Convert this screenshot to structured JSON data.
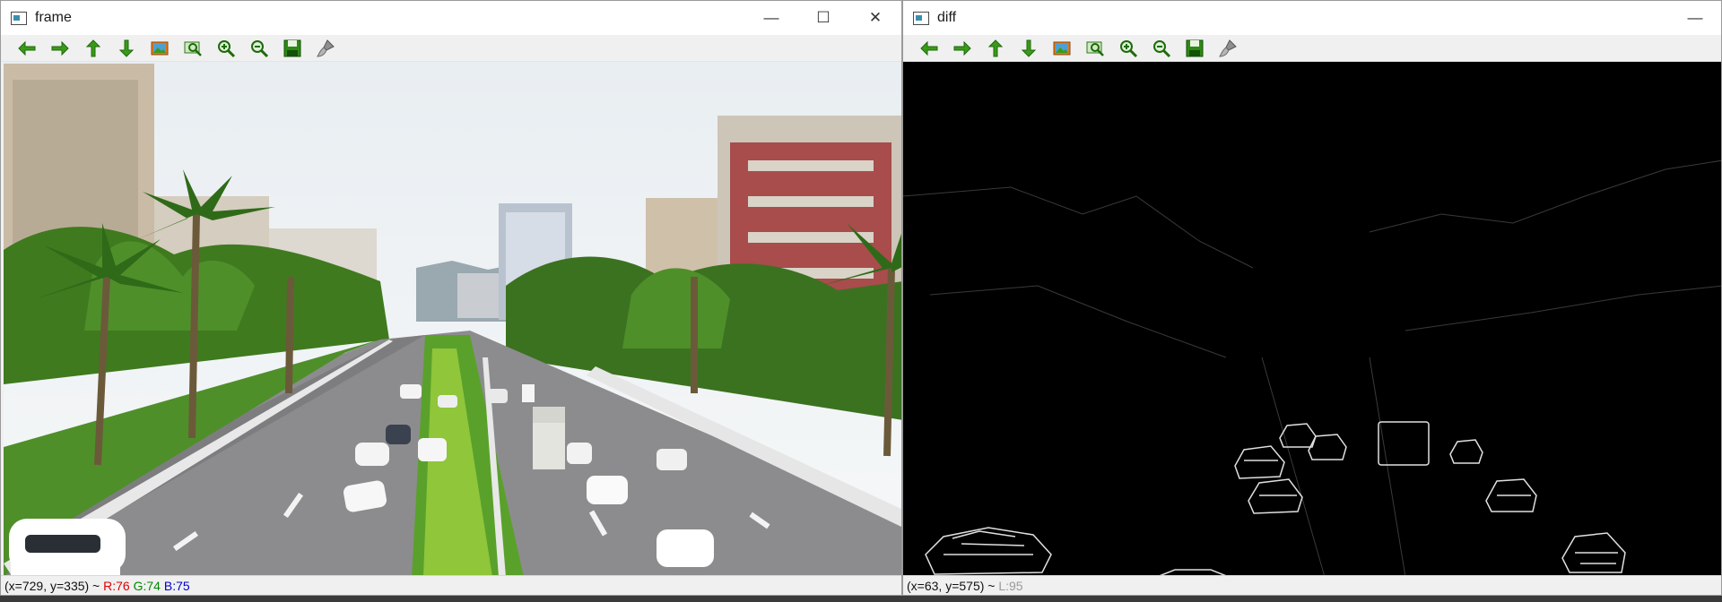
{
  "frame_window": {
    "title": "frame",
    "status": {
      "coords": "(x=729, y=335) ~",
      "r": "R:76",
      "g": "G:74",
      "b": "B:75"
    }
  },
  "diff_window": {
    "title": "diff",
    "status": {
      "coords": "(x=63, y=575) ~",
      "l": "L:95"
    }
  },
  "window_controls": {
    "minimize": "—",
    "maximize": "☐",
    "close": "✕"
  },
  "toolbar_icons": [
    "arrow-left-icon",
    "arrow-right-icon",
    "arrow-up-icon",
    "arrow-down-icon",
    "image-icon",
    "zoom-rect-icon",
    "zoom-in-icon",
    "zoom-out-icon",
    "save-icon",
    "brush-icon"
  ],
  "colors": {
    "toolbar_green": "#3a9a1a",
    "status_red": "#e00000",
    "status_green": "#008800",
    "status_blue": "#0000cc"
  }
}
